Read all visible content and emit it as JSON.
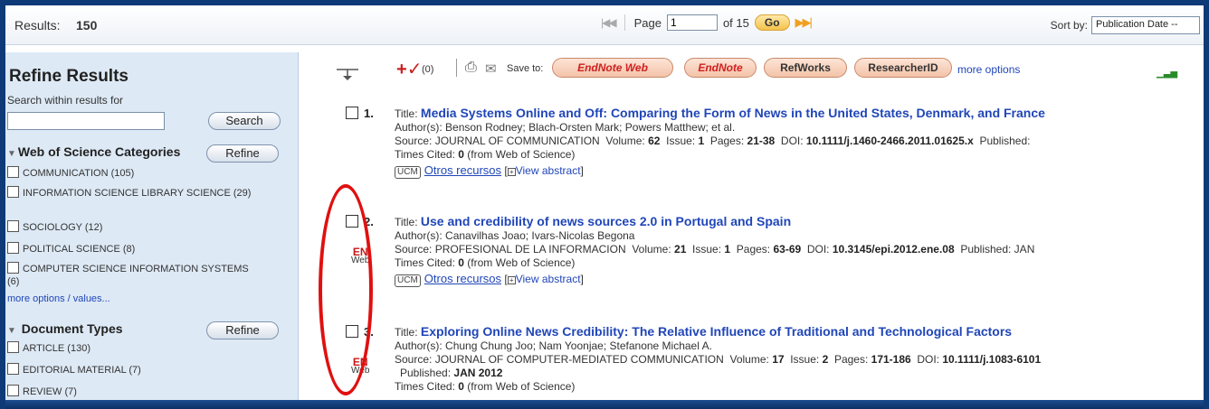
{
  "topbar": {
    "results_label": "Results:",
    "results_count": "150",
    "page_label": "Page",
    "page_value": "1",
    "of_pages": "of 15",
    "go_label": "Go",
    "sort_label": "Sort by:",
    "sort_value": "Publication Date --"
  },
  "sidebar": {
    "title": "Refine Results",
    "search_within": "Search within results for",
    "search_button": "Search",
    "facets": [
      {
        "heading": "Web of Science Categories",
        "refine": "Refine",
        "items": [
          "COMMUNICATION (105)",
          "INFORMATION SCIENCE LIBRARY SCIENCE (29)",
          "SOCIOLOGY (12)",
          "POLITICAL SCIENCE (8)",
          "COMPUTER SCIENCE INFORMATION SYSTEMS (6)"
        ],
        "more": "more options / values..."
      },
      {
        "heading": "Document Types",
        "refine": "Refine",
        "items": [
          "ARTICLE (130)",
          "EDITORIAL MATERIAL (7)",
          "REVIEW (7)"
        ]
      }
    ]
  },
  "toolbar": {
    "add_count": "(0)",
    "save_to": "Save to:",
    "endnote_web_a": "EndNote",
    "endnote_web_b": "Web",
    "endnote": "EndNote",
    "refworks": "RefWorks",
    "researcherid": "ResearcherID",
    "more_options": "more options"
  },
  "labels": {
    "title": "Title:",
    "authors": "Author(s):",
    "source": "Source:",
    "volume": "Volume:",
    "issue": "Issue:",
    "pages": "Pages:",
    "doi": "DOI:",
    "published": "Published:",
    "times_cited": "Times Cited:",
    "from_wos": "(from Web of Science)",
    "ucm": "UCM",
    "otros": "Otros recursos",
    "view_abstract": "View abstract",
    "en": "EN",
    "web": "Web"
  },
  "records": [
    {
      "num": "1.",
      "title": "Media Systems Online and Off: Comparing the Form of News in the United States, Denmark, and France",
      "authors": "Benson Rodney; Blach-Orsten Mark; Powers Matthew; et al.",
      "source": "JOURNAL OF COMMUNICATION",
      "volume": "62",
      "issue": "1",
      "pages": "21-38",
      "doi": "10.1111/j.1460-2466.2011.01625.x",
      "published_inline": "Published:",
      "times_cited": "0"
    },
    {
      "num": "2.",
      "title": "Use and credibility of news sources 2.0 in Portugal and Spain",
      "authors": "Canavilhas Joao; Ivars-Nicolas Begona",
      "source": "PROFESIONAL DE LA INFORMACION",
      "volume": "21",
      "issue": "1",
      "pages": "63-69",
      "doi": "10.3145/epi.2012.ene.08",
      "published_inline": "Published: JAN",
      "times_cited": "0"
    },
    {
      "num": "3.",
      "title": "Exploring Online News Credibility: The Relative Influence of Traditional and Technological Factors",
      "authors": "Chung Chung Joo; Nam Yoonjae; Stefanone Michael A.",
      "source": "JOURNAL OF COMPUTER-MEDIATED COMMUNICATION",
      "volume": "17",
      "issue": "2",
      "pages": "171-186",
      "doi": "10.1111/j.1083-6101",
      "published": "JAN 2012",
      "times_cited": "0"
    }
  ],
  "colors": {
    "frame": "#0f3a78",
    "sidebar_bg": "#dde9f5",
    "link": "#2046b8",
    "annotation": "#e01010",
    "pill": "#f3c3a8"
  }
}
